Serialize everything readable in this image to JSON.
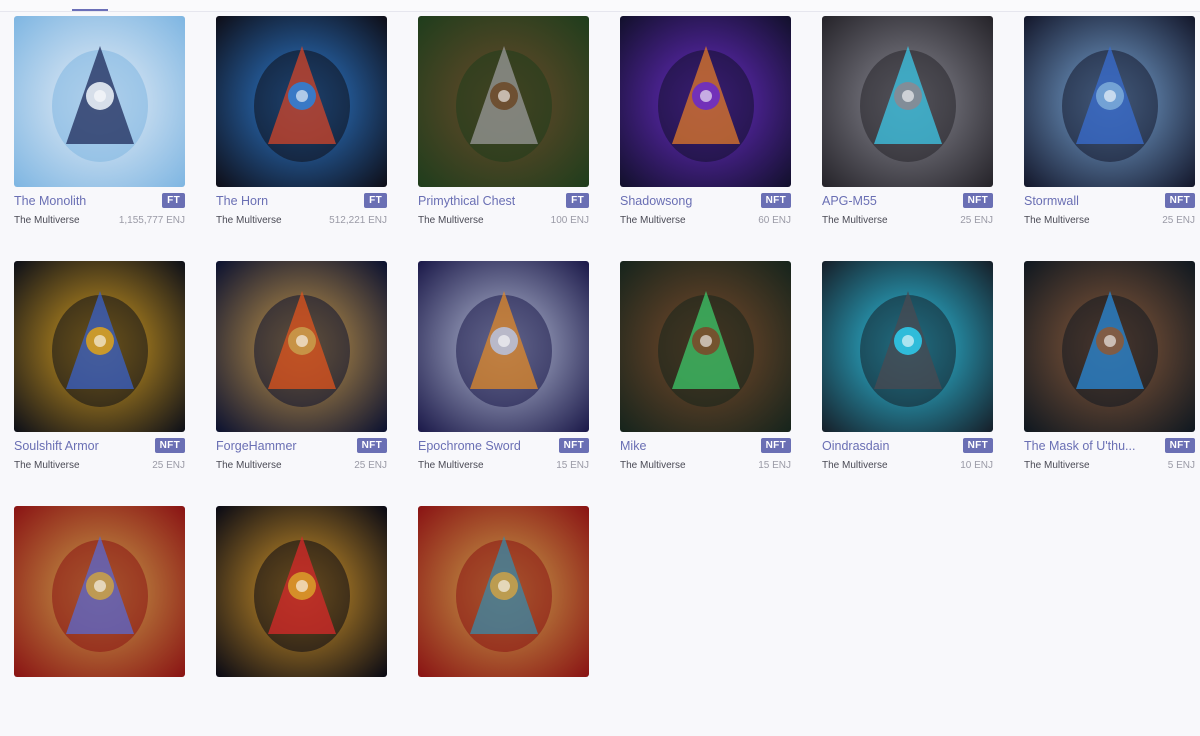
{
  "items": [
    {
      "name": "The Monolith",
      "type": "FT",
      "creator": "The Multiverse",
      "price": "1,155,777 ENJ",
      "palette": [
        "#7fb6e2",
        "#e8eef6",
        "#1e2a5a"
      ]
    },
    {
      "name": "The Horn",
      "type": "FT",
      "creator": "The Multiverse",
      "price": "512,221 ENJ",
      "palette": [
        "#0e0e18",
        "#2e7fd6",
        "#d2452a"
      ]
    },
    {
      "name": "Primythical Chest",
      "type": "FT",
      "creator": "The Multiverse",
      "price": "100 ENJ",
      "palette": [
        "#1f3d1c",
        "#6b4a2a",
        "#9a9a9a"
      ]
    },
    {
      "name": "Shadowsong",
      "type": "NFT",
      "creator": "The Multiverse",
      "price": "60 ENJ",
      "palette": [
        "#12102c",
        "#6a2cc8",
        "#e07a2a"
      ]
    },
    {
      "name": "APG-M55",
      "type": "NFT",
      "creator": "The Multiverse",
      "price": "25 ENJ",
      "palette": [
        "#26242a",
        "#8a8a94",
        "#3ec8e8"
      ]
    },
    {
      "name": "Stormwall",
      "type": "NFT",
      "creator": "The Multiverse",
      "price": "25 ENJ",
      "palette": [
        "#14182c",
        "#7aa8d8",
        "#3a6ed0"
      ]
    },
    {
      "name": "Soulshift Armor",
      "type": "NFT",
      "creator": "The Multiverse",
      "price": "25 ENJ",
      "palette": [
        "#0e1018",
        "#d8a020",
        "#3a62c8"
      ]
    },
    {
      "name": "ForgeHammer",
      "type": "NFT",
      "creator": "The Multiverse",
      "price": "25 ENJ",
      "palette": [
        "#0c1230",
        "#c89a4a",
        "#e0541e"
      ]
    },
    {
      "name": "Epochrome Sword",
      "type": "NFT",
      "creator": "The Multiverse",
      "price": "15 ENJ",
      "palette": [
        "#1c1a4a",
        "#b8c0d8",
        "#e08a2a"
      ]
    },
    {
      "name": "Mike",
      "type": "NFT",
      "creator": "The Multiverse",
      "price": "15 ENJ",
      "palette": [
        "#16241c",
        "#7a4a2a",
        "#3ec86a"
      ]
    },
    {
      "name": "Oindrasdain",
      "type": "NFT",
      "creator": "The Multiverse",
      "price": "10 ENJ",
      "palette": [
        "#16202a",
        "#2ec8e8",
        "#4a4a52"
      ]
    },
    {
      "name": "The Mask of U'thu...",
      "type": "NFT",
      "creator": "The Multiverse",
      "price": "5 ENJ",
      "palette": [
        "#101820",
        "#8a5a3a",
        "#2a8ad8"
      ]
    },
    {
      "name": "",
      "type": "",
      "creator": "",
      "price": "",
      "palette": [
        "#8a1414",
        "#c8a04a",
        "#5a6ad0"
      ]
    },
    {
      "name": "",
      "type": "",
      "creator": "",
      "price": "",
      "palette": [
        "#0a0a14",
        "#d89a2a",
        "#d82a2a"
      ]
    },
    {
      "name": "",
      "type": "",
      "creator": "",
      "price": "",
      "palette": [
        "#8a1414",
        "#c8a04a",
        "#3a8aa8"
      ]
    }
  ]
}
